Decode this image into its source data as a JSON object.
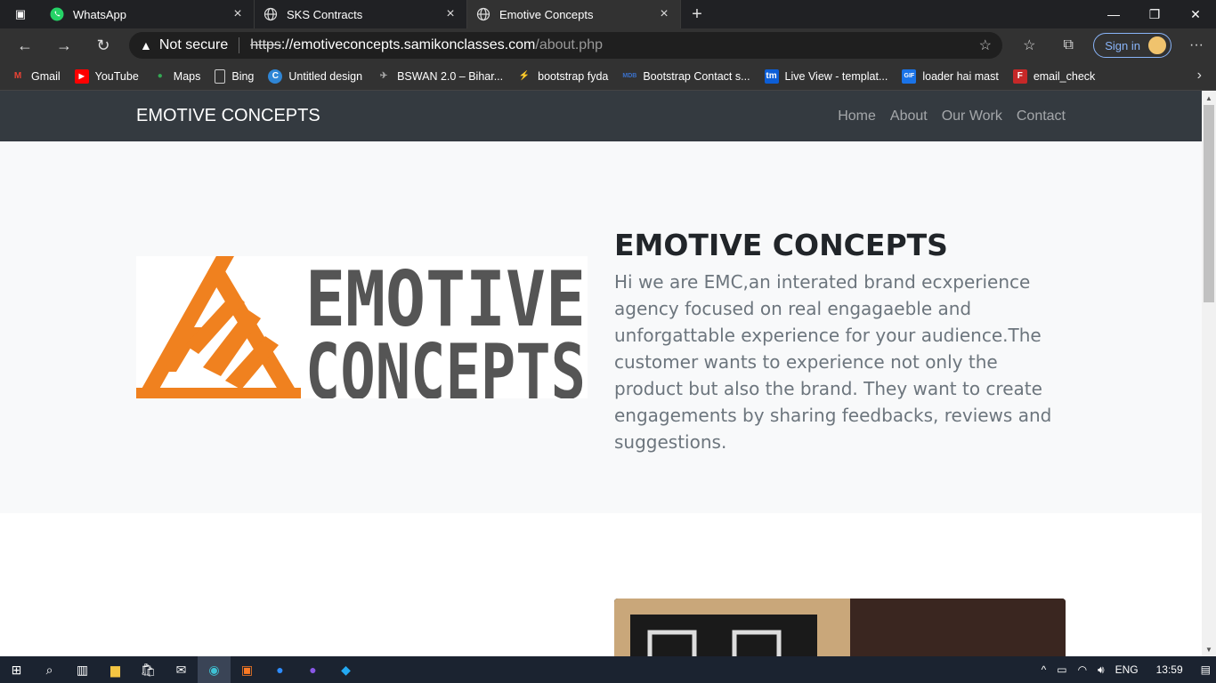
{
  "browser": {
    "tabs": [
      {
        "title": "WhatsApp",
        "icon": "whatsapp-icon",
        "active": false
      },
      {
        "title": "SKS Contracts",
        "icon": "globe-icon",
        "active": false
      },
      {
        "title": "Emotive Concepts",
        "icon": "globe-icon",
        "active": true
      }
    ],
    "security_label": "Not secure",
    "url_scheme": "https",
    "url_host": "://emotiveconcepts.samikonclasses.com",
    "url_path": "/about.php",
    "signin_label": "Sign in",
    "bookmarks": [
      {
        "label": "Gmail",
        "icon": "gmail-icon",
        "color": "#ea4335"
      },
      {
        "label": "YouTube",
        "icon": "youtube-icon",
        "color": "#ff0000"
      },
      {
        "label": "Maps",
        "icon": "maps-icon",
        "color": "#34a853"
      },
      {
        "label": "Bing",
        "icon": "page-icon",
        "color": "#cccccc"
      },
      {
        "label": "Untitled design",
        "icon": "canva-icon",
        "color": "#2f86d6"
      },
      {
        "label": "BSWAN 2.0 – Bihar...",
        "icon": "plane-icon",
        "color": "#aaaaaa"
      },
      {
        "label": "bootstrap fyda",
        "icon": "stackblitz-icon",
        "color": "#1389fd"
      },
      {
        "label": "Bootstrap Contact s...",
        "icon": "mdb-icon",
        "color": "#3b71ca"
      },
      {
        "label": "Live View - templat...",
        "icon": "tm-icon",
        "color": "#0c5ed7"
      },
      {
        "label": "loader hai mast",
        "icon": "gif-icon",
        "color": "#1a73e8"
      },
      {
        "label": "email_check",
        "icon": "email-check-icon",
        "color": "#c62828"
      }
    ]
  },
  "site": {
    "brand": "EMOTIVE CONCEPTS",
    "menu": [
      "Home",
      "About",
      "Our Work",
      "Contact"
    ],
    "hero_title": "EMOTIVE CONCEPTS",
    "hero_text": "Hi we are EMC,an interated brand ecxperience agency focused on real engagaeble and unforgattable experience for your audience.The customer wants to experience not only the product but also the brand. They want to create engagements by sharing feedbacks, reviews and suggestions.",
    "logo_word1": "EMOTIVE",
    "logo_word2": "CONCEPTS",
    "logo_accent": "#f0811f",
    "logo_dark": "#555555"
  },
  "taskbar": {
    "apps": [
      "windows-start-icon",
      "search-icon",
      "task-view-icon",
      "file-explorer-icon",
      "store-icon",
      "mail-icon",
      "edge-icon",
      "xampp-icon",
      "zoom-icon",
      "github-icon",
      "vscode-icon"
    ],
    "language": "ENG",
    "time": "13:59"
  }
}
